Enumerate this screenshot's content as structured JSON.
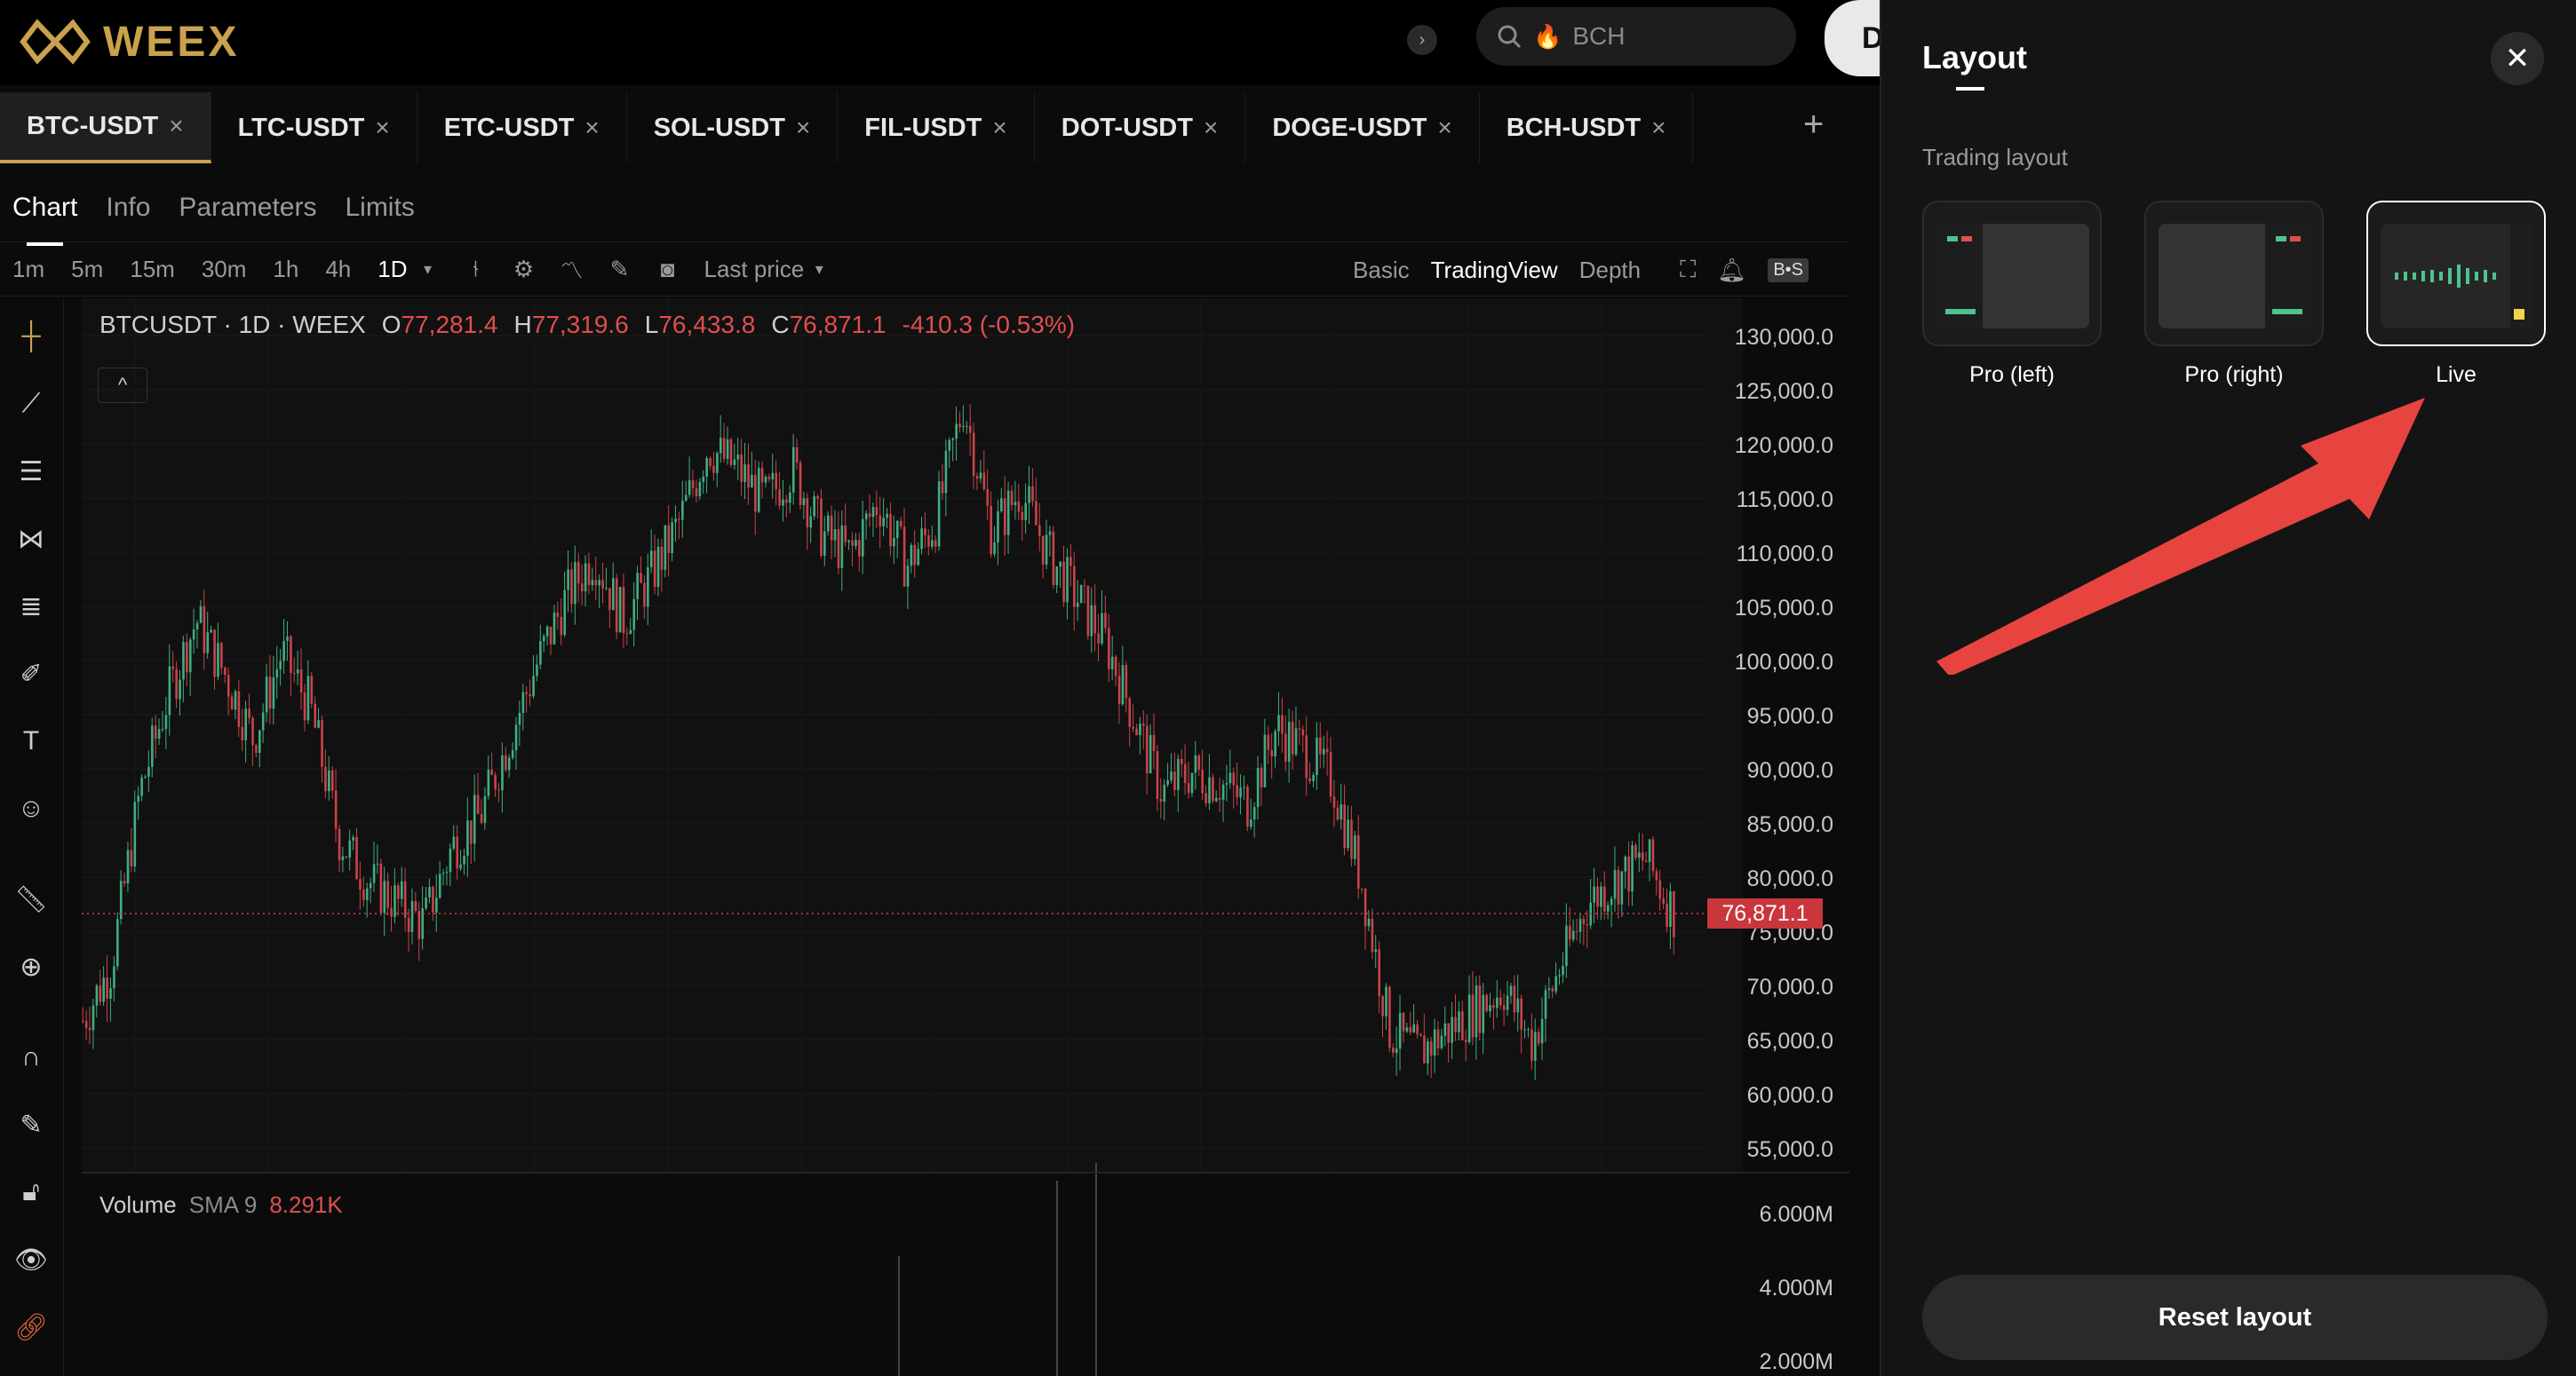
{
  "brand": {
    "name": "WEEX"
  },
  "search": {
    "placeholder": "BCH"
  },
  "partial_button": {
    "label": "D"
  },
  "tabs": [
    {
      "label": "BTC-USDT",
      "active": true
    },
    {
      "label": "LTC-USDT",
      "active": false
    },
    {
      "label": "ETC-USDT",
      "active": false
    },
    {
      "label": "SOL-USDT",
      "active": false
    },
    {
      "label": "FIL-USDT",
      "active": false
    },
    {
      "label": "DOT-USDT",
      "active": false
    },
    {
      "label": "DOGE-USDT",
      "active": false
    },
    {
      "label": "BCH-USDT",
      "active": false
    }
  ],
  "subtabs": [
    "Chart",
    "Info",
    "Parameters",
    "Limits"
  ],
  "toolbar": {
    "timeframes": [
      "1m",
      "5m",
      "15m",
      "30m",
      "1h",
      "4h",
      "1D"
    ],
    "active_timeframe": "1D",
    "price_type": "Last price",
    "views": [
      "Basic",
      "TradingView",
      "Depth"
    ],
    "active_view": "TradingView",
    "bs_badge": "B•S"
  },
  "chart_header": {
    "symbol": "BTCUSDT · 1D · WEEX",
    "o_label": "O",
    "o_value": "77,281.4",
    "h_label": "H",
    "h_value": "77,319.6",
    "l_label": "L",
    "l_value": "76,433.8",
    "c_label": "C",
    "c_value": "76,871.1",
    "change": "-410.3 (-0.53%)"
  },
  "price_axis": [
    "130,000.0",
    "125,000.0",
    "120,000.0",
    "115,000.0",
    "110,000.0",
    "105,000.0",
    "100,000.0",
    "95,000.0",
    "90,000.0",
    "85,000.0",
    "80,000.0",
    "75,000.0",
    "70,000.0",
    "65,000.0",
    "60,000.0",
    "55,000.0"
  ],
  "current_price": "76,871.1",
  "volume": {
    "label": "Volume",
    "sma": "SMA 9",
    "value": "8.291K",
    "axis": [
      "6.000M",
      "4.000M",
      "2.000M"
    ]
  },
  "panel": {
    "title": "Layout",
    "section": "Trading layout",
    "options": [
      {
        "label": "Pro (left)",
        "selected": false
      },
      {
        "label": "Pro (right)",
        "selected": false
      },
      {
        "label": "Live",
        "selected": true
      }
    ],
    "reset_label": "Reset layout"
  },
  "chart_data": {
    "type": "candlestick",
    "title": "BTCUSDT · 1D · WEEX",
    "ylim": [
      55000,
      130000
    ],
    "series": [
      {
        "name": "BTCUSDT",
        "approx_close_path": [
          67000,
          72000,
          88000,
          97000,
          104000,
          99000,
          93000,
          101000,
          96000,
          84000,
          80000,
          78000,
          76000,
          83000,
          86000,
          93000,
          100000,
          106000,
          110000,
          104000,
          108000,
          113000,
          120000,
          118000,
          115000,
          118000,
          112000,
          110000,
          115000,
          109000,
          113000,
          124000,
          112000,
          116000,
          110000,
          106000,
          102000,
          95000,
          88000,
          90000,
          89000,
          87000,
          94000,
          92000,
          89000,
          80000,
          66000,
          64000,
          66000,
          68000,
          70000,
          65000,
          72000,
          78000,
          80000,
          82000,
          76871
        ]
      }
    ]
  }
}
